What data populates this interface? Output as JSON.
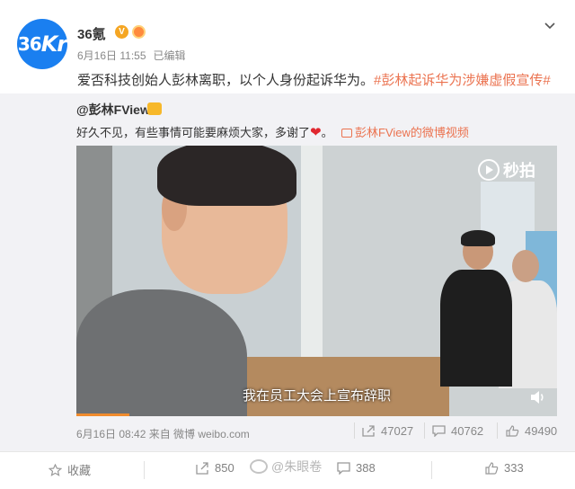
{
  "post": {
    "author": "36氪",
    "date": "6月16日 11:55",
    "edited": "已编辑",
    "text_main": "爱否科技创始人彭林离职，以个人身份起诉华为。",
    "hashtag": "#彭林起诉华为涉嫌虚假宣传#",
    "avatar_text_num": "36",
    "avatar_text_k": "Kr"
  },
  "repost": {
    "author": "@彭林FView",
    "text": "好久不见，有些事情可能要麻烦大家，多谢了",
    "heart": "❤",
    "period": "。",
    "video_link": "彭林FView的微博视频",
    "footer": "6月16日 08:42 来自 微博 weibo.com",
    "shares": "47027",
    "comments": "40762",
    "likes": "49490"
  },
  "video": {
    "logo": "秒拍",
    "subtitle": "我在员工大会上宣布辞职",
    "progress": 0.11
  },
  "bottom": {
    "favorite": "收藏",
    "shares": "850",
    "comments": "388",
    "likes": "333",
    "watermark": "@朱眼卷"
  },
  "icons": [
    "chevron-down-icon",
    "verified-icon",
    "member-icon",
    "video-link-icon",
    "miaopai-logo-icon",
    "sound-icon",
    "share-icon",
    "comment-icon",
    "like-icon",
    "favorite-icon",
    "weibo-watermark-icon"
  ],
  "colors": {
    "link": "#eb7350",
    "avatar": "#1a7ff0",
    "progress": "#f08b2d"
  }
}
